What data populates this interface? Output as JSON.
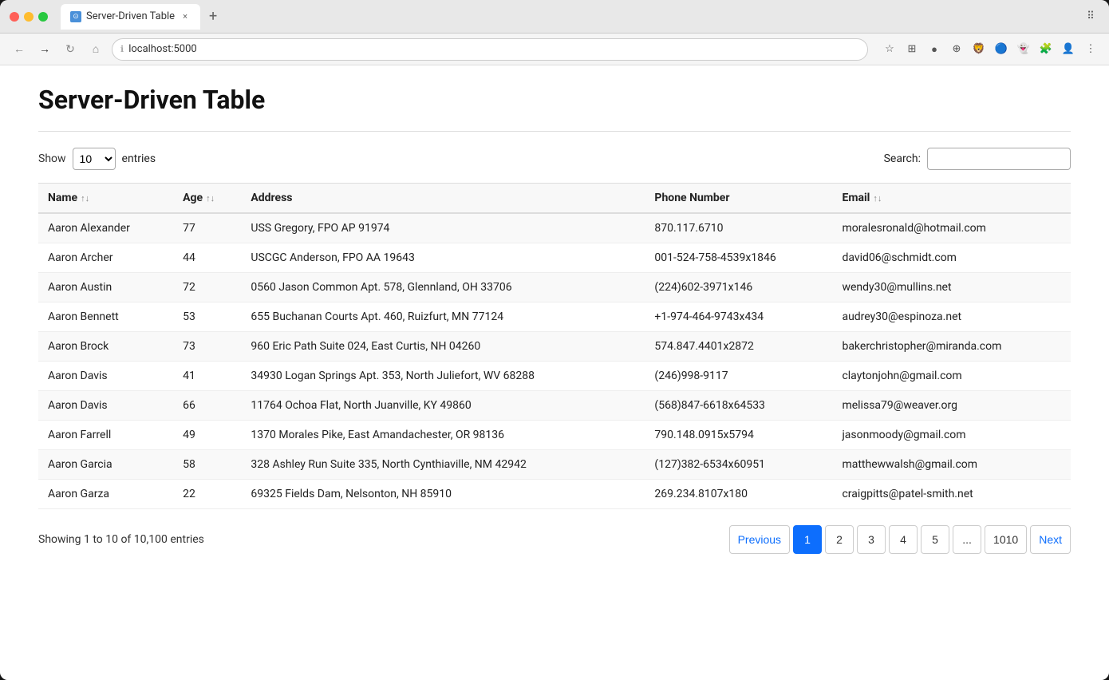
{
  "browser": {
    "tab_title": "Server-Driven Table",
    "url": "localhost:5000",
    "tab_close": "×",
    "new_tab": "+"
  },
  "page": {
    "title": "Server-Driven Table",
    "show_label": "Show",
    "entries_label": "entries",
    "entries_value": "10",
    "search_label": "Search:",
    "search_placeholder": ""
  },
  "table": {
    "columns": [
      {
        "id": "name",
        "label": "Name",
        "sortable": true,
        "sort_icon": "↑↓"
      },
      {
        "id": "age",
        "label": "Age",
        "sortable": true,
        "sort_icon": "↑↓"
      },
      {
        "id": "address",
        "label": "Address",
        "sortable": false
      },
      {
        "id": "phone",
        "label": "Phone Number",
        "sortable": false
      },
      {
        "id": "email",
        "label": "Email",
        "sortable": true,
        "sort_icon": "↑↓"
      }
    ],
    "rows": [
      {
        "name": "Aaron Alexander",
        "age": "77",
        "address": "USS Gregory, FPO AP 91974",
        "phone": "870.117.6710",
        "email": "moralesronald@hotmail.com"
      },
      {
        "name": "Aaron Archer",
        "age": "44",
        "address": "USCGC Anderson, FPO AA 19643",
        "phone": "001-524-758-4539x1846",
        "email": "david06@schmidt.com"
      },
      {
        "name": "Aaron Austin",
        "age": "72",
        "address": "0560 Jason Common Apt. 578, Glennland, OH 33706",
        "phone": "(224)602-3971x146",
        "email": "wendy30@mullins.net"
      },
      {
        "name": "Aaron Bennett",
        "age": "53",
        "address": "655 Buchanan Courts Apt. 460, Ruizfurt, MN 77124",
        "phone": "+1-974-464-9743x434",
        "email": "audrey30@espinoza.net"
      },
      {
        "name": "Aaron Brock",
        "age": "73",
        "address": "960 Eric Path Suite 024, East Curtis, NH 04260",
        "phone": "574.847.4401x2872",
        "email": "bakerchristopher@miranda.com"
      },
      {
        "name": "Aaron Davis",
        "age": "41",
        "address": "34930 Logan Springs Apt. 353, North Juliefort, WV 68288",
        "phone": "(246)998-9117",
        "email": "claytonjohn@gmail.com"
      },
      {
        "name": "Aaron Davis",
        "age": "66",
        "address": "11764 Ochoa Flat, North Juanville, KY 49860",
        "phone": "(568)847-6618x64533",
        "email": "melissa79@weaver.org"
      },
      {
        "name": "Aaron Farrell",
        "age": "49",
        "address": "1370 Morales Pike, East Amandachester, OR 98136",
        "phone": "790.148.0915x5794",
        "email": "jasonmoody@gmail.com"
      },
      {
        "name": "Aaron Garcia",
        "age": "58",
        "address": "328 Ashley Run Suite 335, North Cynthiaville, NM 42942",
        "phone": "(127)382-6534x60951",
        "email": "matthewwalsh@gmail.com"
      },
      {
        "name": "Aaron Garza",
        "age": "22",
        "address": "69325 Fields Dam, Nelsonton, NH 85910",
        "phone": "269.234.8107x180",
        "email": "craigpitts@patel-smith.net"
      }
    ]
  },
  "pagination": {
    "info": "Showing 1 to 10 of 10,100 entries",
    "previous": "Previous",
    "next": "Next",
    "ellipsis": "...",
    "pages": [
      "1",
      "2",
      "3",
      "4",
      "5",
      "1010"
    ],
    "current_page": "1"
  }
}
